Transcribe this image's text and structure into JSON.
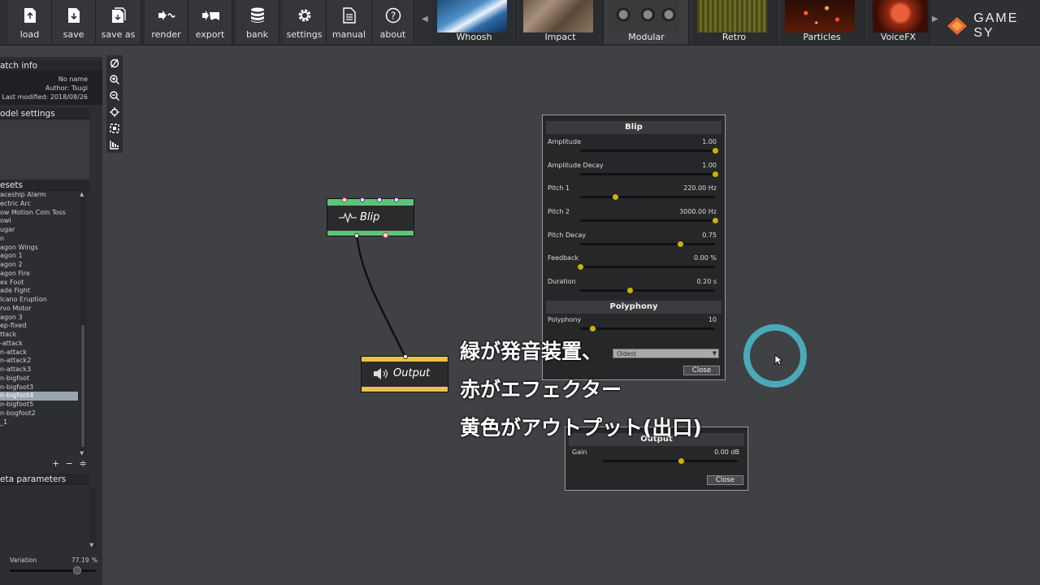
{
  "toolbar": {
    "buttons": [
      {
        "label": "load",
        "icon": "load-icon"
      },
      {
        "label": "save",
        "icon": "save-icon"
      },
      {
        "label": "save as",
        "icon": "save-as-icon"
      },
      {
        "label": "render",
        "icon": "render-icon"
      },
      {
        "label": "export",
        "icon": "export-icon"
      },
      {
        "label": "bank",
        "icon": "bank-icon"
      },
      {
        "label": "settings",
        "icon": "gear-icon"
      },
      {
        "label": "manual",
        "icon": "document-icon"
      },
      {
        "label": "about",
        "icon": "question-icon"
      }
    ],
    "categories": [
      "Whoosh",
      "Impact",
      "Modular",
      "Retro",
      "Particles",
      "VoiceFX"
    ],
    "active_category": "Modular",
    "brand": "GAME SY"
  },
  "left": {
    "patch_info": "atch info",
    "name": "No name",
    "author": "Author: Tsugi",
    "modified": "Last modified: 2018/08/26",
    "model_settings": "odel settings",
    "presets_title": "esets",
    "presets": [
      "aceship Alarm",
      "ectric Arc",
      "ow Motion Coin Toss",
      "owl",
      "ugar",
      "n",
      "agon Wings",
      "agon 1",
      "agon 2",
      "agon Fire",
      "ex Foot",
      "ade Fight",
      "lcano Eruption",
      "rvo Motor",
      "agon 3",
      "",
      "",
      "ep-fixed",
      "ttack",
      "-attack",
      "n-attack",
      "n-attack2",
      "n-attack3",
      "n-bigfoot",
      "n-bigfoot3",
      "n-bigfoot4",
      "n-bigfoot5",
      "n-bogfoot2",
      "_1"
    ],
    "selected_preset": "n-bigfoot4",
    "preset_controls": [
      "+",
      "−",
      "≑"
    ],
    "meta_parameters": "eta parameters",
    "variation_label": "Variation",
    "variation_value": "77.19",
    "variation_unit": "%"
  },
  "nodes": {
    "blip": "Blip",
    "output": "Output"
  },
  "blip_window": {
    "title": "Blip",
    "params": [
      {
        "name": "Amplitude",
        "value": "1.00",
        "fraction": 1.0
      },
      {
        "name": "Amplitude Decay",
        "value": "1.00",
        "fraction": 1.0
      },
      {
        "name": "Pitch 1",
        "value": "220.00 Hz",
        "fraction": 0.26
      },
      {
        "name": "Pitch 2",
        "value": "3000.00 Hz",
        "fraction": 1.0
      },
      {
        "name": "Pitch Decay",
        "value": "0.75",
        "fraction": 0.74
      },
      {
        "name": "Feedback",
        "value": "0.00 %",
        "fraction": 0.0
      },
      {
        "name": "Duration",
        "value": "0.20 s",
        "fraction": 0.37
      }
    ],
    "section2": "Polyphony",
    "polyphony": {
      "name": "Polyphony",
      "value": "10",
      "fraction": 0.09
    },
    "dropdown": "Oldest",
    "close": "Close"
  },
  "output_window": {
    "title": "Output",
    "gain_label": "Gain",
    "gain_value": "0.00 dB",
    "gain_fraction": 0.58,
    "close": "Close"
  },
  "subtitles": [
    "緑が発音装置、",
    "赤がエフェクター",
    "黄色がアウトプット(出口)"
  ],
  "colors": {
    "accent_teal": "#4aaab8",
    "generator_green": "#5cc47a",
    "output_yellow": "#e8c24a",
    "knob_yellow": "#c8b400"
  }
}
